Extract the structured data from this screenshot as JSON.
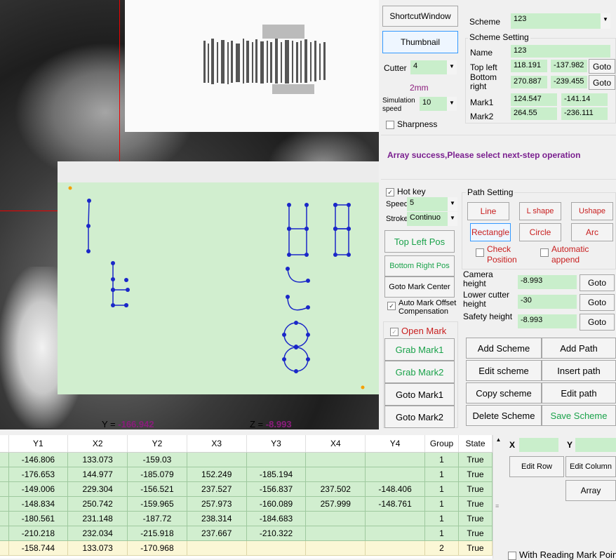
{
  "buttons": {
    "shortcut": "ShortcutWindow",
    "thumbnail": "Thumbnail",
    "goto_topleft": "Goto",
    "goto_bottomright": "Goto",
    "line": "Line",
    "lshape": "L shape",
    "ushape": "Ushape",
    "rectangle": "Rectangle",
    "circle": "Circle",
    "arc": "Arc",
    "top_left_pos": "Top Left Pos",
    "bottom_right_pos": "Bottom Right Pos",
    "goto_mark_center": "Goto Mark Center",
    "goto_camera": "Goto",
    "goto_lower": "Goto",
    "goto_safety": "Goto",
    "grab_mark1": "Grab Mark1",
    "grab_mark2": "Grab Mark2",
    "goto_mark1": "Goto Mark1",
    "goto_mark2": "Goto Mark2",
    "add_scheme": "Add Scheme",
    "add_path": "Add Path",
    "edit_scheme": "Edit scheme",
    "insert_path": "Insert path",
    "copy_scheme": "Copy scheme",
    "edit_path": "Edit path",
    "delete_scheme": "Delete Scheme",
    "save_scheme": "Save Scheme",
    "edit_row": "Edit Row",
    "edit_column": "Edit Column",
    "array": "Array"
  },
  "cutter": {
    "label": "Cutter",
    "value": "4",
    "size": "2mm"
  },
  "simulation": {
    "label": "Simulation speed",
    "value": "10"
  },
  "sharpness": "Sharpness",
  "scheme": {
    "label": "Scheme",
    "value": "123",
    "setting_title": "Scheme Setting",
    "name_label": "Name",
    "name": "123",
    "top_left_label": "Top left",
    "top_left_x": "118.191",
    "top_left_y": "-137.982",
    "bottom_right_label": "Bottom right",
    "bottom_right_x": "270.887",
    "bottom_right_y": "-239.455",
    "mark1_label": "Mark1",
    "mark1_x": "124.547",
    "mark1_y": "-141.14",
    "mark2_label": "Mark2",
    "mark2_x": "264.55",
    "mark2_y": "-236.111"
  },
  "status_message": "Array success,Please select next-step operation",
  "hotkey": {
    "label": "Hot key",
    "checked": true
  },
  "speed": {
    "label": "Speed",
    "value": "5"
  },
  "stroke": {
    "label": "Stroke",
    "value": "Continuo"
  },
  "path_setting": {
    "title": "Path Setting",
    "check_position": "Check Position",
    "automatic_append": "Automatic append"
  },
  "auto_mark": "Auto Mark Offset Compensation",
  "open_mark": "Open Mark",
  "heights": {
    "camera_label": "Camera height",
    "camera": "-8.993",
    "lower_label": "Lower cutter height",
    "lower": "-30",
    "safety_label": "Safety height",
    "safety": "-8.993"
  },
  "coords": {
    "y_label": "Y = ",
    "y": "-166.942",
    "z_label": "Z = ",
    "z": "-8.993"
  },
  "grid": {
    "headers": [
      "Y1",
      "X2",
      "Y2",
      "X3",
      "Y3",
      "X4",
      "Y4",
      "Group",
      "State"
    ],
    "rows": [
      [
        "-146.806",
        "133.073",
        "-159.03",
        "",
        "",
        "",
        "",
        "1",
        "True"
      ],
      [
        "-176.653",
        "144.977",
        "-185.079",
        "152.249",
        "-185.194",
        "",
        "",
        "1",
        "True"
      ],
      [
        "-149.006",
        "229.304",
        "-156.521",
        "237.527",
        "-156.837",
        "237.502",
        "-148.406",
        "1",
        "True"
      ],
      [
        "-148.834",
        "250.742",
        "-159.965",
        "257.973",
        "-160.089",
        "257.999",
        "-148.761",
        "1",
        "True"
      ],
      [
        "-180.561",
        "231.148",
        "-187.72",
        "238.314",
        "-184.683",
        "",
        "",
        "1",
        "True"
      ],
      [
        "-210.218",
        "232.034",
        "-215.918",
        "237.667",
        "-210.322",
        "",
        "",
        "1",
        "True"
      ],
      [
        "-158.744",
        "133.073",
        "-170.968",
        "",
        "",
        "",
        "",
        "2",
        "True"
      ]
    ]
  },
  "side": {
    "x_label": "X",
    "y_label": "Y",
    "reading_mark": "With Reading Mark Point"
  },
  "colors": {
    "path": "#1a27c8",
    "dot": "#f5a000",
    "field": "#c9eecb",
    "canvas": "#d1eecf"
  }
}
